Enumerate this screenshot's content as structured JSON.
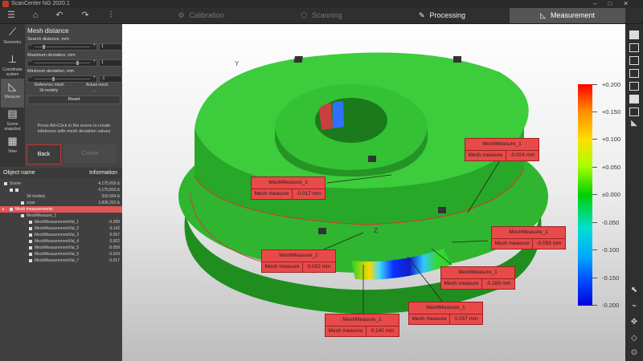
{
  "app": {
    "title": "ScanCenter NG 2020.1"
  },
  "toolbar": {
    "tabs": [
      {
        "label": "Calibration",
        "icon": "gear-icon",
        "state": "inactive"
      },
      {
        "label": "Scanning",
        "icon": "cube-icon",
        "state": "inactive"
      },
      {
        "label": "Processing",
        "icon": "pencil-icon",
        "state": "active"
      },
      {
        "label": "Measurement",
        "icon": "triangle-ruler-icon",
        "state": "selected"
      }
    ]
  },
  "sidebar": {
    "tools": [
      {
        "label": "Geometry",
        "icon": "geometry-icon"
      },
      {
        "label": "Coordinate system",
        "icon": "axes-icon"
      },
      {
        "label": "Measure",
        "icon": "measure-icon"
      },
      {
        "label": "Scene snapshot",
        "icon": "snapshot-icon"
      },
      {
        "label": "View",
        "icon": "view-icon"
      }
    ]
  },
  "mesh_distance": {
    "title": "Mesh distance",
    "search_label": "Search distance, mm",
    "search_value": "1",
    "max_label": "Maximum deviation, mm",
    "max_value": "1",
    "min_label": "Minimum deviation, mm",
    "min_value": "-1",
    "ref_header": "Reference mesh",
    "actual_header": "Actual mesh",
    "ref_value": "3d modely",
    "actual_value": "...",
    "reset_label": "Reset",
    "hint": "Press Alt+Click in the scene to create infoboxes with mesh deviation values",
    "back_label": "Back",
    "create_label": "Create"
  },
  "object_panel": {
    "name_header": "Object name",
    "info_header": "Information",
    "rows": [
      {
        "name": "Scene",
        "info": "4,175,816 Δ"
      },
      {
        "name": "",
        "info": "4,175,816 Δ"
      },
      {
        "name": "3d modely",
        "info": "339,564 Δ"
      },
      {
        "name": "scan",
        "info": "3,836,252 Δ"
      },
      {
        "name": "Mesh measurements",
        "info": ""
      },
      {
        "name": "MeshMeasure_1",
        "info": ""
      },
      {
        "name": "MeshMeasurementVal_1",
        "info": "-0.289"
      },
      {
        "name": "MeshMeasurementVal_2",
        "info": "0.142"
      },
      {
        "name": "MeshMeasurementVal_3",
        "info": "0.057"
      },
      {
        "name": "MeshMeasurementVal_4",
        "info": "0.002"
      },
      {
        "name": "MeshMeasurementVal_5",
        "info": "-0.059"
      },
      {
        "name": "MeshMeasurementVal_6",
        "info": "-0.024"
      },
      {
        "name": "MeshMeasurementVal_7",
        "info": "-0.017"
      }
    ]
  },
  "colorbar": {
    "labels": [
      "+0.200",
      "+0.150",
      "+0.100",
      "+0.050",
      "±0.000",
      "-0.050",
      "-0.100",
      "-0.150",
      "-0.200"
    ],
    "colors": [
      "#ff0000",
      "#00d000",
      "#0000e0"
    ]
  },
  "annotations": [
    {
      "title": "MeshMeasure_1",
      "key": "Mesh measure",
      "value": "-0.024 mm"
    },
    {
      "title": "MeshMeasure_1",
      "key": "Mesh measure",
      "value": "-0.017 mm"
    },
    {
      "title": "MeshMeasure_1",
      "key": "Mesh measure",
      "value": "-0.059 mm"
    },
    {
      "title": "MeshMeasure_1",
      "key": "Mesh measure",
      "value": "0.002 mm"
    },
    {
      "title": "MeshMeasure_1",
      "key": "Mesh measure",
      "value": "-0.289 mm"
    },
    {
      "title": "MeshMeasure_1",
      "key": "Mesh measure",
      "value": "0.057 mm"
    },
    {
      "title": "MeshMeasure_1",
      "key": "Mesh measure",
      "value": "0.142 mm"
    }
  ],
  "axes": {
    "y": "Y",
    "z": "Z"
  }
}
